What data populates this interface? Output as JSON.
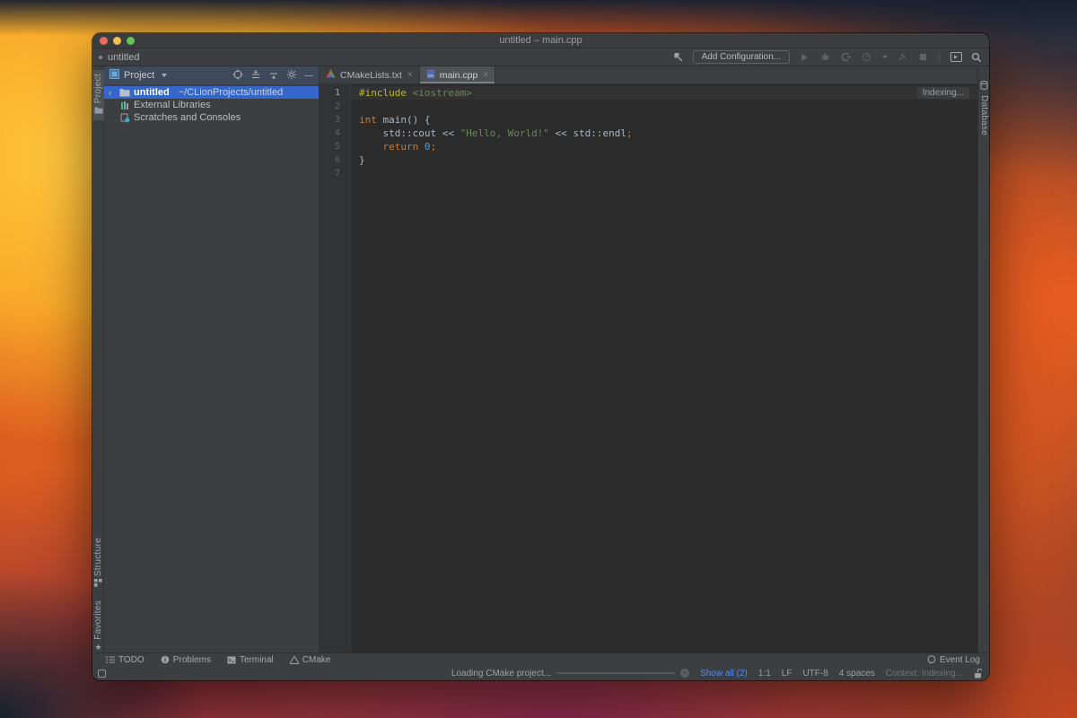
{
  "colors": {
    "selection_blue": "#3566C9",
    "link_blue": "#548AF7",
    "editor_bg": "#2B2B2B",
    "panel_bg": "#3C3F41",
    "focused_header_bg": "#3E4A5A",
    "keyword": "#CC7832",
    "directive": "#BBB529",
    "string": "#6A8759",
    "number": "#6897BB",
    "plain": "#A9B7C6"
  },
  "titlebar": {
    "title": "untitled – main.cpp"
  },
  "navbar": {
    "project_crumb": "untitled"
  },
  "toolbar": {
    "add_configuration": "Add Configuration..."
  },
  "left_stripe": {
    "project_tab": "Project",
    "structure_tab": "Structure",
    "favorites_tab": "Favorites"
  },
  "right_stripe": {
    "database_tab": "Database"
  },
  "project_panel": {
    "title": "Project",
    "items": [
      {
        "name": "untitled",
        "path": "~/CLionProjects/untitled"
      },
      {
        "name": "External Libraries"
      },
      {
        "name": "Scratches and Consoles"
      }
    ]
  },
  "editor": {
    "tabs": [
      {
        "label": "CMakeLists.txt"
      },
      {
        "label": "main.cpp"
      }
    ],
    "indexing": "Indexing...",
    "code": {
      "lines": [
        [
          [
            "d",
            "#include"
          ],
          [
            "p",
            " "
          ],
          [
            "inc",
            "<iostream>"
          ]
        ],
        [],
        [
          [
            "k",
            "int"
          ],
          [
            "p",
            " main() {"
          ]
        ],
        [
          [
            "p",
            "    std::cout << "
          ],
          [
            "s",
            "\"Hello, World!\""
          ],
          [
            "p",
            " << std::endl"
          ],
          [
            "sc",
            ";"
          ]
        ],
        [
          [
            "p",
            "    "
          ],
          [
            "k",
            "return"
          ],
          [
            "p",
            " "
          ],
          [
            "n",
            "0"
          ],
          [
            "sc",
            ";"
          ]
        ],
        [
          [
            "p",
            "}"
          ]
        ],
        []
      ]
    }
  },
  "bottom_bar": {
    "todo": "TODO",
    "problems": "Problems",
    "terminal": "Terminal",
    "cmake": "CMake",
    "event_log": "Event Log"
  },
  "status_bar": {
    "loading": "Loading CMake project...",
    "show_all": "Show all (2)",
    "caret_pos": "1:1",
    "line_sep": "LF",
    "encoding": "UTF-8",
    "indent": "4 spaces",
    "context": "Context: Indexing..."
  },
  "icons": {
    "close": "×",
    "chevron_right": "›",
    "cancel": "×",
    "favorites_star": "★",
    "minus": "—"
  }
}
